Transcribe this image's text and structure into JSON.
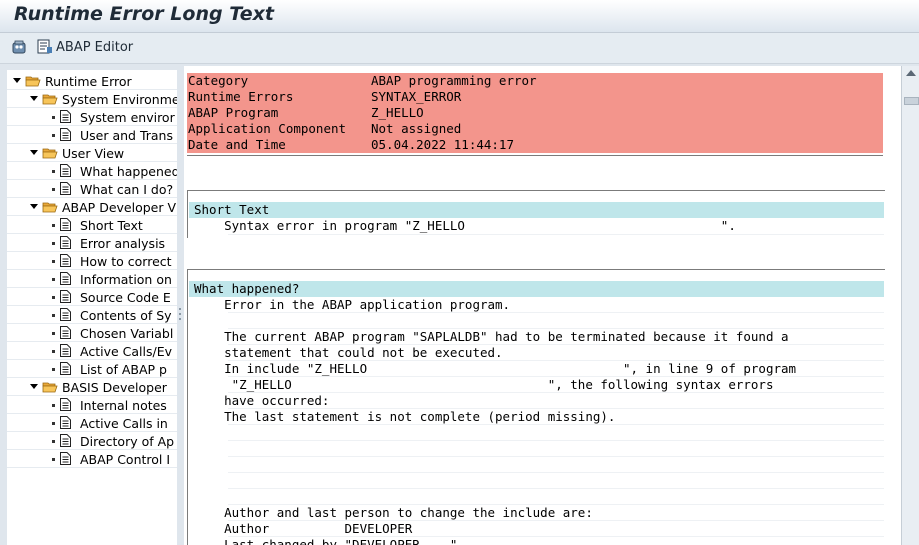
{
  "window": {
    "title": "Runtime Error Long Text"
  },
  "toolbar": {
    "abap_editor_label": "ABAP Editor"
  },
  "tree": {
    "items": [
      {
        "level": 0,
        "type": "folder",
        "label": "Runtime Error"
      },
      {
        "level": 1,
        "type": "folder",
        "label": "System Environme"
      },
      {
        "level": 2,
        "type": "doc",
        "label": "System enviror"
      },
      {
        "level": 2,
        "type": "doc",
        "label": "User and Trans"
      },
      {
        "level": 1,
        "type": "folder",
        "label": "User View"
      },
      {
        "level": 2,
        "type": "doc",
        "label": "What happened"
      },
      {
        "level": 2,
        "type": "doc",
        "label": "What can I do?"
      },
      {
        "level": 1,
        "type": "folder",
        "label": "ABAP Developer V"
      },
      {
        "level": 2,
        "type": "doc",
        "label": "Short Text"
      },
      {
        "level": 2,
        "type": "doc",
        "label": "Error analysis"
      },
      {
        "level": 2,
        "type": "doc",
        "label": "How to correct"
      },
      {
        "level": 2,
        "type": "doc",
        "label": "Information on"
      },
      {
        "level": 2,
        "type": "doc",
        "label": "Source Code E"
      },
      {
        "level": 2,
        "type": "doc",
        "label": "Contents of Sy"
      },
      {
        "level": 2,
        "type": "doc",
        "label": "Chosen Variabl"
      },
      {
        "level": 2,
        "type": "doc",
        "label": "Active Calls/Ev"
      },
      {
        "level": 2,
        "type": "doc",
        "label": "List of ABAP p"
      },
      {
        "level": 1,
        "type": "folder",
        "label": "BASIS Developer"
      },
      {
        "level": 2,
        "type": "doc",
        "label": "Internal notes"
      },
      {
        "level": 2,
        "type": "doc",
        "label": "Active Calls in"
      },
      {
        "level": 2,
        "type": "doc",
        "label": "Directory of Ap"
      },
      {
        "level": 2,
        "type": "doc",
        "label": "ABAP Control I"
      }
    ]
  },
  "header_table": {
    "rows": [
      {
        "key": "Category",
        "value": "ABAP programming error"
      },
      {
        "key": "Runtime Errors",
        "value": "SYNTAX_ERROR"
      },
      {
        "key": "ABAP Program",
        "value": "Z_HELLO"
      },
      {
        "key": "Application Component",
        "value": "Not assigned"
      },
      {
        "key": "Date and Time",
        "value": "05.04.2022 11:44:17"
      }
    ]
  },
  "short_text": {
    "heading": "Short Text",
    "line": "    Syntax error in program \"Z_HELLO                                  \"."
  },
  "what_happened": {
    "heading": "What happened?",
    "lines": [
      "    Error in the ABAP application program.",
      "",
      "    The current ABAP program \"SAPLALDB\" had to be terminated because it found a",
      "    statement that could not be executed.",
      "    In include \"Z_HELLO                                  \", in line 9 of program",
      "     \"Z_HELLO                                  \", the following syntax errors",
      "    have occurred:",
      "    The last statement is not complete (period missing).",
      "",
      "",
      "",
      "",
      "",
      "    Author and last person to change the include are:",
      "    Author          DEVELOPER",
      "    Last changed by \"DEVELOPER    \""
    ]
  }
}
